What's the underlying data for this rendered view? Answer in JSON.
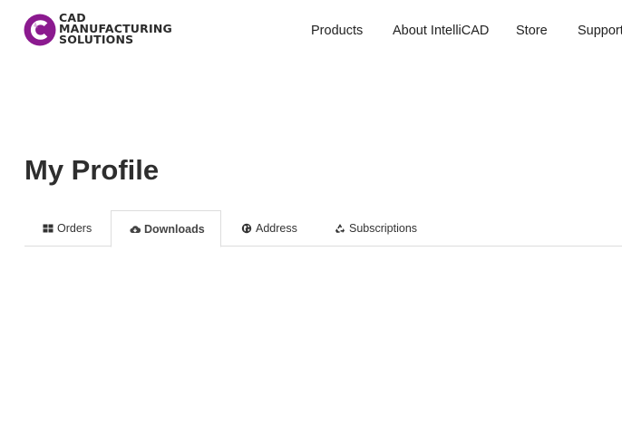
{
  "logo": {
    "line1": "CAD",
    "line2": "MANUFACTURING",
    "line3": "SOLUTIONS",
    "brand_color": "#8b1a8f"
  },
  "nav": {
    "items": [
      {
        "label": "Products"
      },
      {
        "label": "About IntelliCAD"
      },
      {
        "label": "Store"
      },
      {
        "label": "Support"
      }
    ]
  },
  "page": {
    "title": "My Profile"
  },
  "tabs": [
    {
      "label": "Orders",
      "icon": "grid-icon",
      "active": false
    },
    {
      "label": "Downloads",
      "icon": "cloud-download-icon",
      "active": true
    },
    {
      "label": "Address",
      "icon": "globe-icon",
      "active": false
    },
    {
      "label": "Subscriptions",
      "icon": "recycle-icon",
      "active": false
    }
  ]
}
